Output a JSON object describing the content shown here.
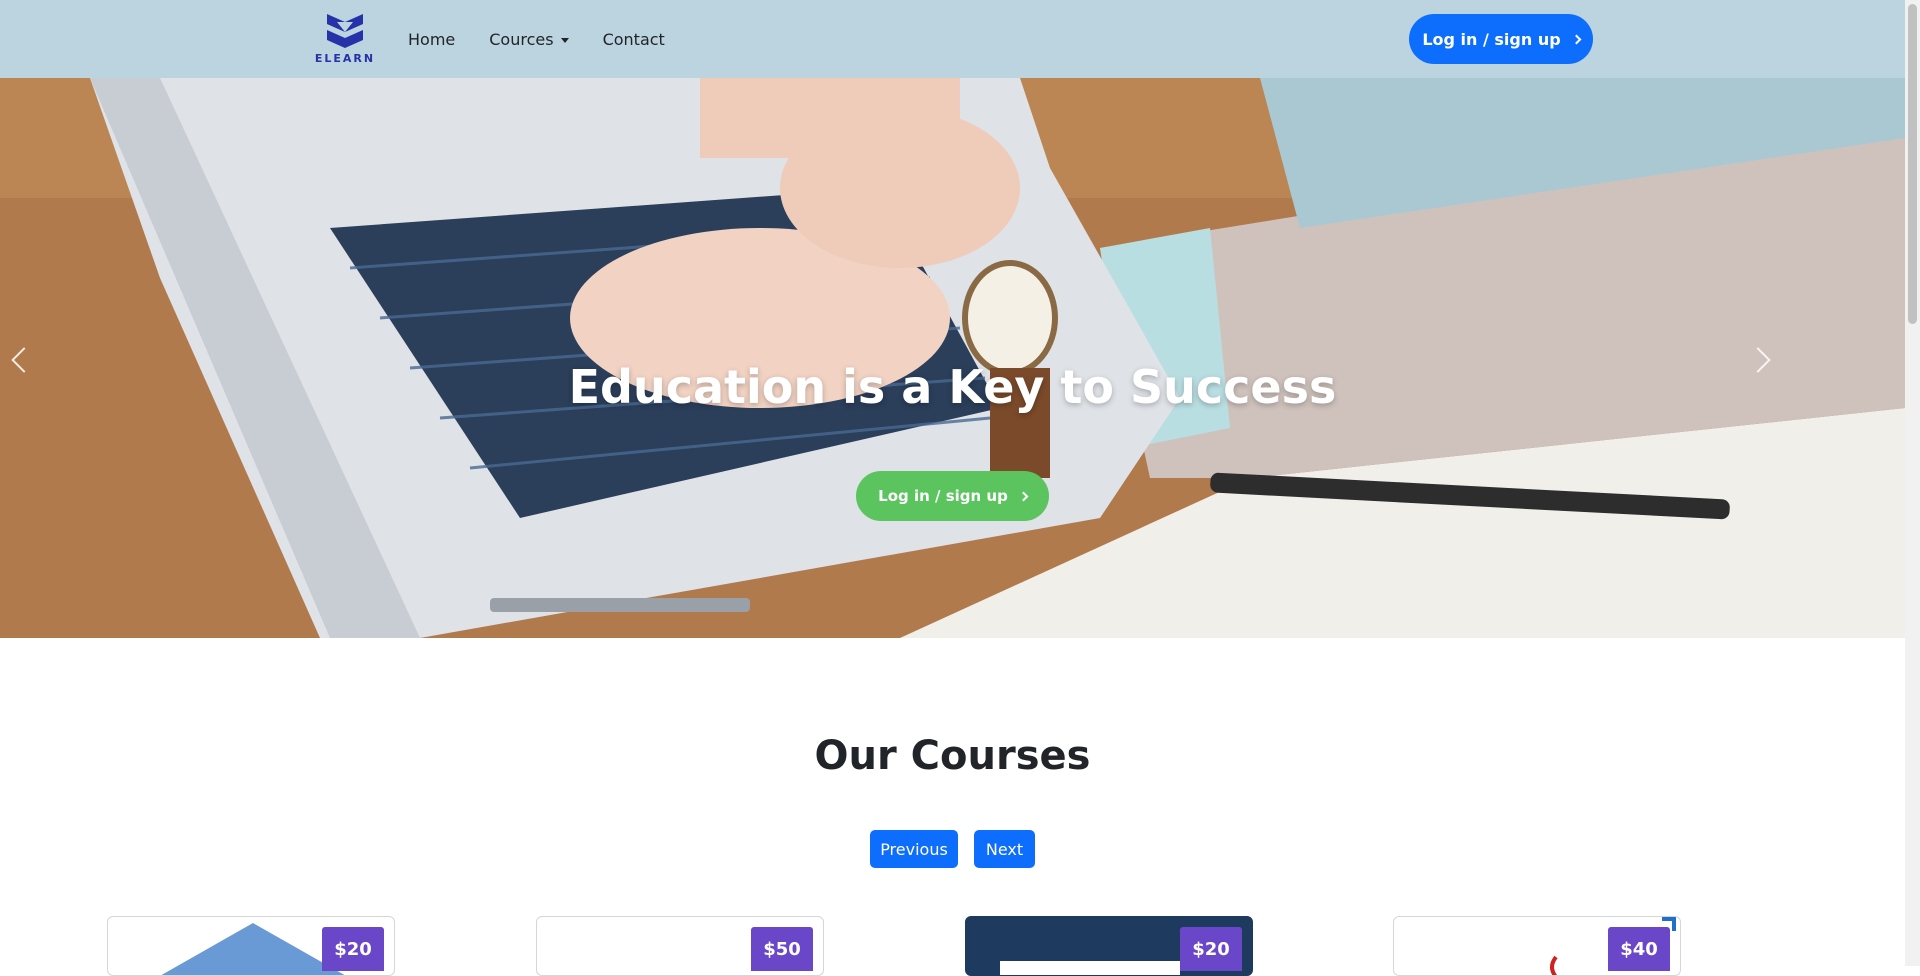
{
  "nav": {
    "brand": "ELEARN",
    "links": [
      "Home",
      "Cources",
      "Contact"
    ],
    "cta": "Log in / sign up"
  },
  "hero": {
    "title": "Education is a Key to Success",
    "cta": "Log in / sign up"
  },
  "courses": {
    "title": "Our Courses",
    "prev": "Previous",
    "next": "Next",
    "prices": [
      "$20",
      "$50",
      "$20",
      "$40"
    ]
  },
  "colors": {
    "nav_bg": "#bcd3e0",
    "primary": "#0d6efd",
    "hero_cta": "#5cc45f",
    "price_badge": "#6a47c8"
  }
}
